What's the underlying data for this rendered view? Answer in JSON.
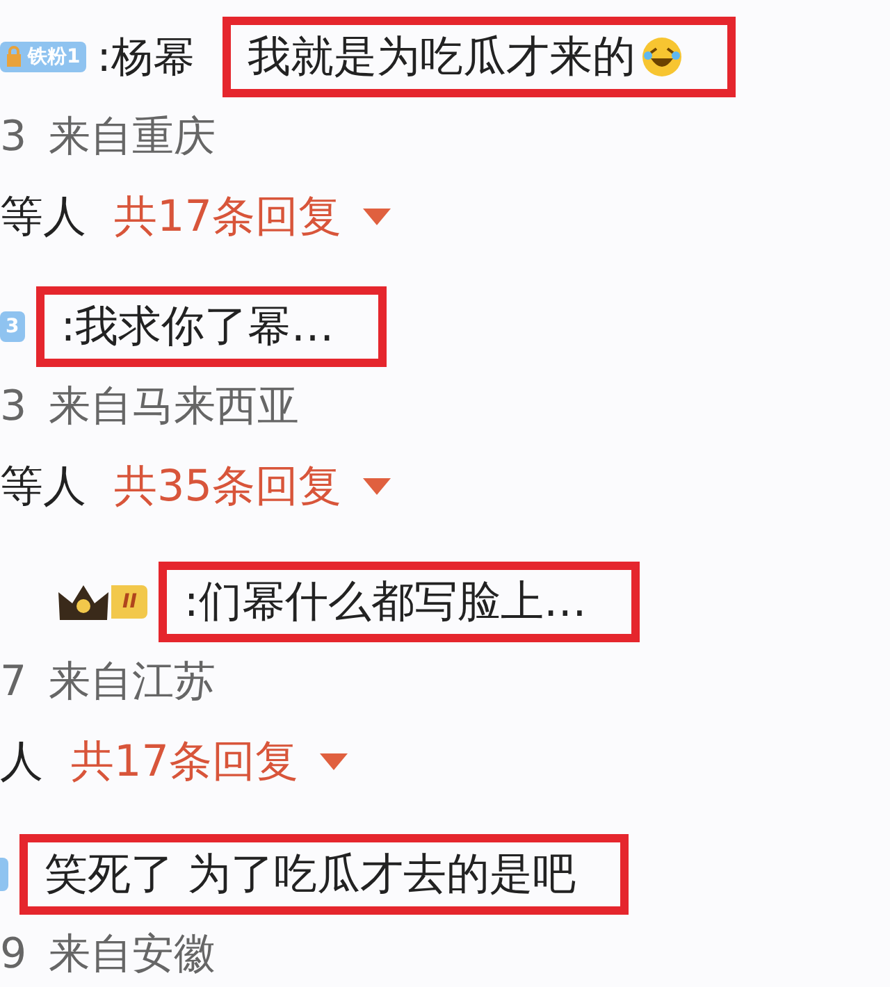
{
  "comments": [
    {
      "badge": {
        "kind": "fan",
        "text": "铁粉1"
      },
      "author": ":杨幂",
      "content": "我就是为吃瓜才来的",
      "emoji": true,
      "highlighted": true,
      "date": "3",
      "location": "来自重庆",
      "replies": {
        "prefix": "等人",
        "count": "共17条回复"
      }
    },
    {
      "badge": {
        "kind": "fan",
        "text": "3"
      },
      "content": ":我求你了幂…",
      "emoji": false,
      "highlighted": true,
      "date": "3",
      "location": "来自马来西亚",
      "replies": {
        "prefix": "等人",
        "count": "共35条回复"
      }
    },
    {
      "badge": {
        "kind": "crown",
        "text": "II"
      },
      "content": ":们幂什么都写脸上…",
      "emoji": false,
      "highlighted": true,
      "date": "7",
      "location": "来自江苏",
      "replies": {
        "prefix": "人",
        "count": "共17条回复"
      }
    },
    {
      "badge": {
        "kind": "sliver"
      },
      "content": "笑死了 为了吃瓜才去的是吧",
      "emoji": false,
      "highlighted": true,
      "date": "9",
      "location": "来自安徽"
    }
  ]
}
